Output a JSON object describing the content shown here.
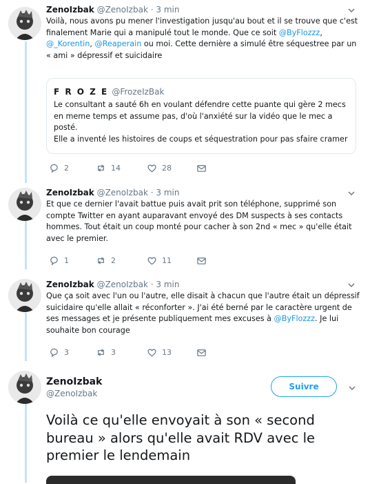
{
  "tweets": [
    {
      "name": "ZenoIzbak",
      "handle": "@ZenoIzbak",
      "time": "3 min",
      "body_parts": [
        "Voilà, nous avons pu mener l'investigation jusqu'au bout et il se trouve que c'est finalement Marie qui a manipulé tout le monde. Que ce soit ",
        "@ByFlozzz",
        ", ",
        "@_Korentin",
        ", ",
        "@Reaperain",
        " ou moi. Cette dernière a simulé être séquestree par un « ami » dépressif et suicidaire"
      ],
      "quote": {
        "name": "F R O Z E",
        "handle": "@FrozeIzBak",
        "text_1": "Le consultant a sauté 6h en voulant défendre cette puante qui gère 2 mecs en meme temps et assume pas, d'où l'anxiété sur la vidéo que le mec a posté.",
        "text_2": "Elle a inventé les histoires de coups et séquestration pour pas sfaire cramer"
      },
      "replies": "2",
      "retweets": "14",
      "likes": "28"
    },
    {
      "name": "ZenoIzbak",
      "handle": "@ZenoIzbak",
      "time": "3 min",
      "body": "Et que ce dernier l'avait battue puis avait prit son téléphone, supprimé son compte Twitter en ayant auparavant envoyé des DM suspects à ses contacts hommes. Tout était un coup monté pour cacher à son 2nd « mec » qu'elle était avec le premier.",
      "replies": "1",
      "retweets": "2",
      "likes": "11"
    },
    {
      "name": "ZenoIzbak",
      "handle": "@ZenoIzbak",
      "time": "3 min",
      "body_parts": [
        "Que ça soit avec l'un ou l'autre, elle disait à chacun que l'autre était un dépressif suicidaire qu'elle allait « réconforter ». J'ai été berné par le caractère urgent de ses messages et je présente publiquement mes excuses à ",
        "@ByFlozzz",
        ". Je lui souhaite bon courage"
      ],
      "replies": "3",
      "retweets": "3",
      "likes": "13"
    }
  ],
  "main": {
    "name": "ZenoIzbak",
    "handle": "@ZenoIzbak",
    "follow_label": "Suivre",
    "text": "Voilà ce qu'elle envoyait à son « second bureau » alors qu'elle avait RDV avec le premier le lendemain"
  },
  "colors": {
    "accent": "#1da1f2",
    "link": "#1b95e0",
    "muted": "#657786",
    "thread_line": "#c4e3f5"
  },
  "icons": [
    "chevron-down-icon",
    "reply-icon",
    "retweet-icon",
    "like-icon",
    "direct-message-icon",
    "avatar-image"
  ]
}
